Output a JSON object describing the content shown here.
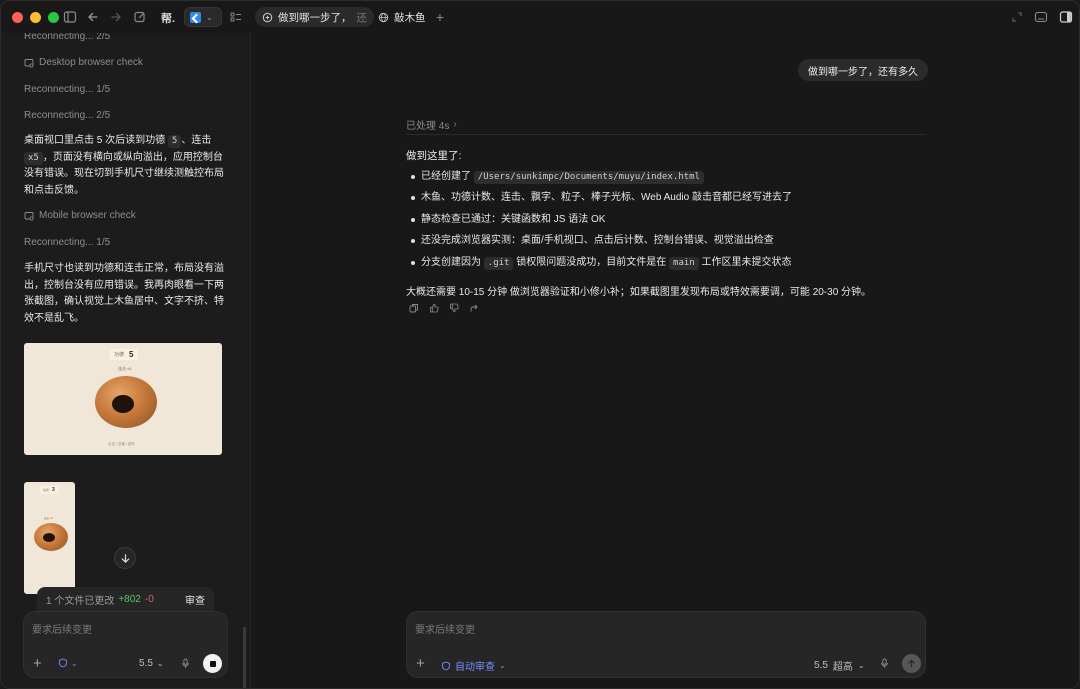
{
  "titlebar": {
    "app_label": "帮.",
    "tabs": [
      {
        "label": "做到哪一步了，",
        "label_fade": "还"
      },
      {
        "label": "敲木鱼"
      }
    ]
  },
  "sidebar": {
    "lines": [
      "Reconnecting... 2/5",
      "Desktop browser check",
      "Reconnecting... 1/5",
      "Reconnecting... 2/5"
    ],
    "para1": {
      "a": "桌面视口里点击 5 次后读到功德 ",
      "chip1": "5",
      "b": "、连击",
      "chip2": "x5",
      "c": "，页面没有横向或纵向溢出，应用控制台没有错误。现在切到手机尺寸继续测触控布局和点击反馈。"
    },
    "mobile_check": "Mobile browser check",
    "reconnecting3": "Reconnecting... 1/5",
    "para2": "手机尺寸也读到功德和连击正常，布局没有溢出，控制台没有应用错误。我再肉眼看一下两张截图，确认视觉上木鱼居中、文字不挤、特效不是乱飞。",
    "thumb_desktop": {
      "counter_label": "功德",
      "counter_value": "5",
      "combo_label": "连击 x5",
      "footer": "点击 / 空格 / 回车"
    },
    "thumb_mobile": {
      "counter_label": "功德",
      "counter_value": "3",
      "combo_label": "连击 x3"
    },
    "changes": {
      "label": "1 个文件已更改",
      "added": "+802",
      "removed": "-0",
      "review": "审查"
    },
    "composer": {
      "placeholder": "要求后续变更",
      "model": "5.5"
    }
  },
  "main": {
    "user_message": "做到哪一步了，还有多久",
    "processed": "已处理 4s",
    "answer_head": "做到这里了:",
    "bullets": [
      {
        "pre": "已经创建了 ",
        "code": "/Users/sunkimpc/Documents/muyu/index.html",
        "post": ""
      },
      {
        "pre": "木鱼、功德计数、连击、飘字、粒子、棒子光标、Web Audio 敲击音都已经写进去了",
        "code": "",
        "post": ""
      },
      {
        "pre": "静态检查已通过：关键函数和 JS 语法 OK",
        "code": "",
        "post": ""
      },
      {
        "pre": "还没完成浏览器实测：桌面/手机视口、点击后计数、控制台错误、视觉溢出检查",
        "code": "",
        "post": ""
      },
      {
        "pre": "分支创建因为 ",
        "code": ".git",
        "post": " 锁权限问题没成功，目前文件是在 ",
        "code2": "main",
        "post2": " 工作区里未提交状态"
      }
    ],
    "summary": "大概还需要 10-15 分钟 做浏览器验证和小修小补；如果截图里发现布局或特效需要调，可能 20-30 分钟。",
    "composer": {
      "placeholder": "要求后续变更",
      "auto_review": "自动审查",
      "model": "5.5",
      "effort": "超高"
    }
  }
}
